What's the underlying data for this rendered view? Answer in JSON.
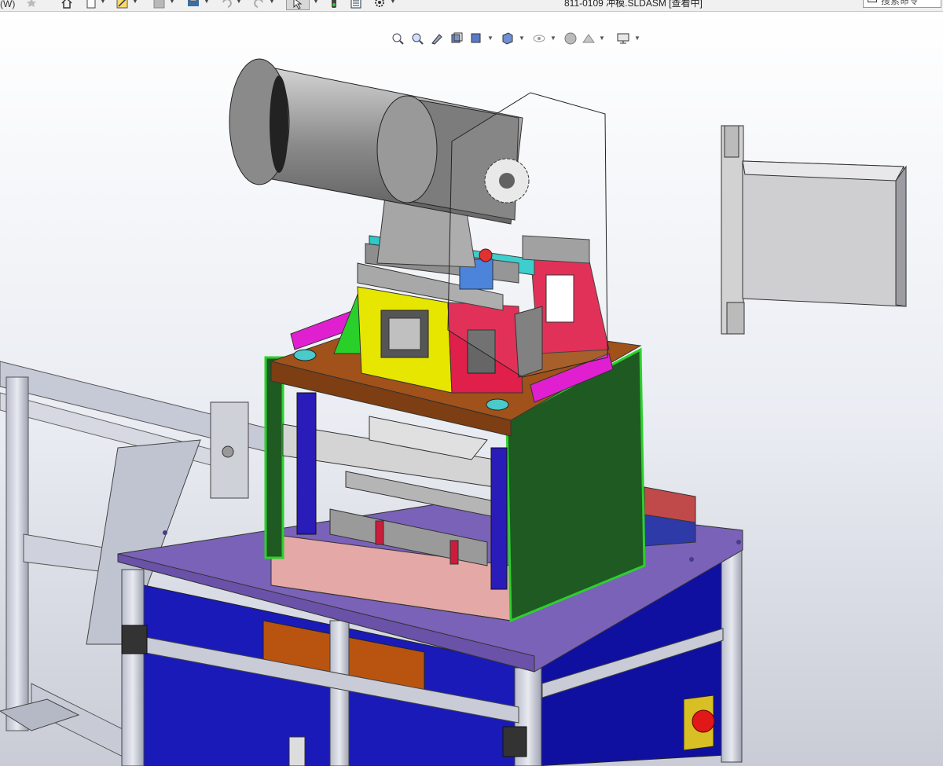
{
  "app": {
    "menu_fragment": "(W)",
    "document_title": "811-0109   冲模.SLDASM [查看中]",
    "search_placeholder": "搜索命令"
  },
  "toolbar": {
    "icons": [
      "pin-icon",
      "home-icon",
      "new-document-icon",
      "open-icon",
      "save-icon",
      "print-icon",
      "undo-icon",
      "redo-icon",
      "select-pointer-icon",
      "traffic-light-icon",
      "file-properties-icon",
      "options-gear-icon"
    ]
  },
  "view_toolbar": {
    "icons": [
      "zoom-to-fit-icon",
      "zoom-to-area-icon",
      "previous-view-icon",
      "section-view-icon",
      "view-orientation-icon",
      "display-style-icon",
      "hide-show-items-icon",
      "edit-appearance-icon",
      "apply-scene-icon",
      "view-settings-icon"
    ]
  },
  "colors": {
    "viewport_top": "#ffffff",
    "viewport_bottom": "#c9ccd6",
    "table_top": "#7a62b8",
    "frame_blue": "#1010b0",
    "green_panel": "#1e5a22",
    "red_block": "#e0204a",
    "yellow_plate": "#e6e600",
    "orange_plate": "#a0521a",
    "magenta_strip": "#e020d0",
    "motor_grey": "#8a8a8a"
  }
}
